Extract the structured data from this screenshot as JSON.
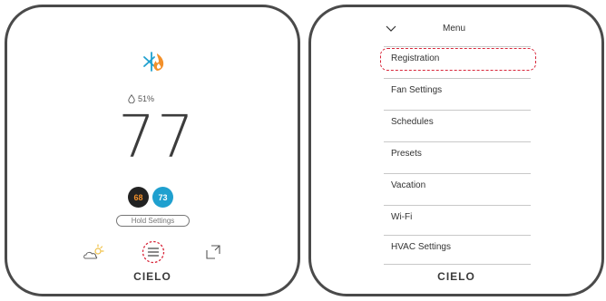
{
  "thermostat": {
    "humidity": "51%",
    "current_temp": "77",
    "heat_setpoint": "68",
    "cool_setpoint": "73",
    "hold_label": "Hold Settings",
    "logo_text": "CIELO"
  },
  "menu": {
    "title": "Menu",
    "items": [
      {
        "label": "Registration"
      },
      {
        "label": "Fan Settings"
      },
      {
        "label": "Schedules"
      },
      {
        "label": "Presets"
      },
      {
        "label": "Vacation"
      },
      {
        "label": "Wi-Fi"
      },
      {
        "label": "HVAC Settings"
      }
    ],
    "logo_text": "CIELO"
  },
  "colors": {
    "heat_setpoint": "#f3902a",
    "cool_setpoint_bg": "#1fa0cf",
    "highlight": "#d8263a"
  },
  "icons": [
    "snowflake-flame-icon",
    "droplet-icon",
    "partly-sunny-icon",
    "menu-icon",
    "expand-icon",
    "chevron-down-icon"
  ]
}
